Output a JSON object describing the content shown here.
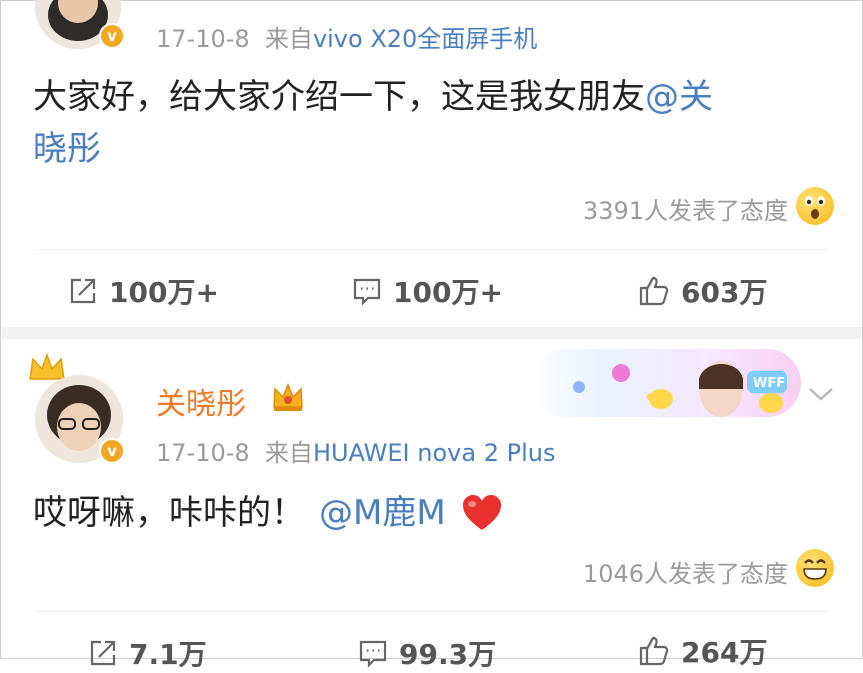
{
  "post1": {
    "date": "17-10-8",
    "source_prefix": "来自",
    "source": "vivo X20全面屏手机",
    "text": "大家好，给大家介绍一下，这是我女朋友",
    "mention_line1": "@关",
    "mention_line2": "晓彤",
    "reaction_text": "3391人发表了态度",
    "reaction_icon": "surprised-emoji",
    "actions": {
      "repost": "100万+",
      "comment": "100万+",
      "like": "603万"
    }
  },
  "post2": {
    "username": "关晓彤",
    "crown_icon": "crown-icon",
    "date": "17-10-8",
    "source_prefix": "来自",
    "source": "HUAWEI nova 2 Plus",
    "text": "哎呀嘛，咔咔的！",
    "mention": "@M鹿M",
    "heart_icon": "red-heart",
    "reaction_text": "1046人发表了态度",
    "reaction_icon": "grin-emoji",
    "banner_label": "WFF",
    "actions": {
      "repost": "7.1万",
      "comment": "99.3万",
      "like": "264万"
    }
  },
  "colors": {
    "accent_link": "#4a7fbf",
    "username": "#f07a26",
    "badge": "#f5a623",
    "heart": "#e8312c"
  }
}
